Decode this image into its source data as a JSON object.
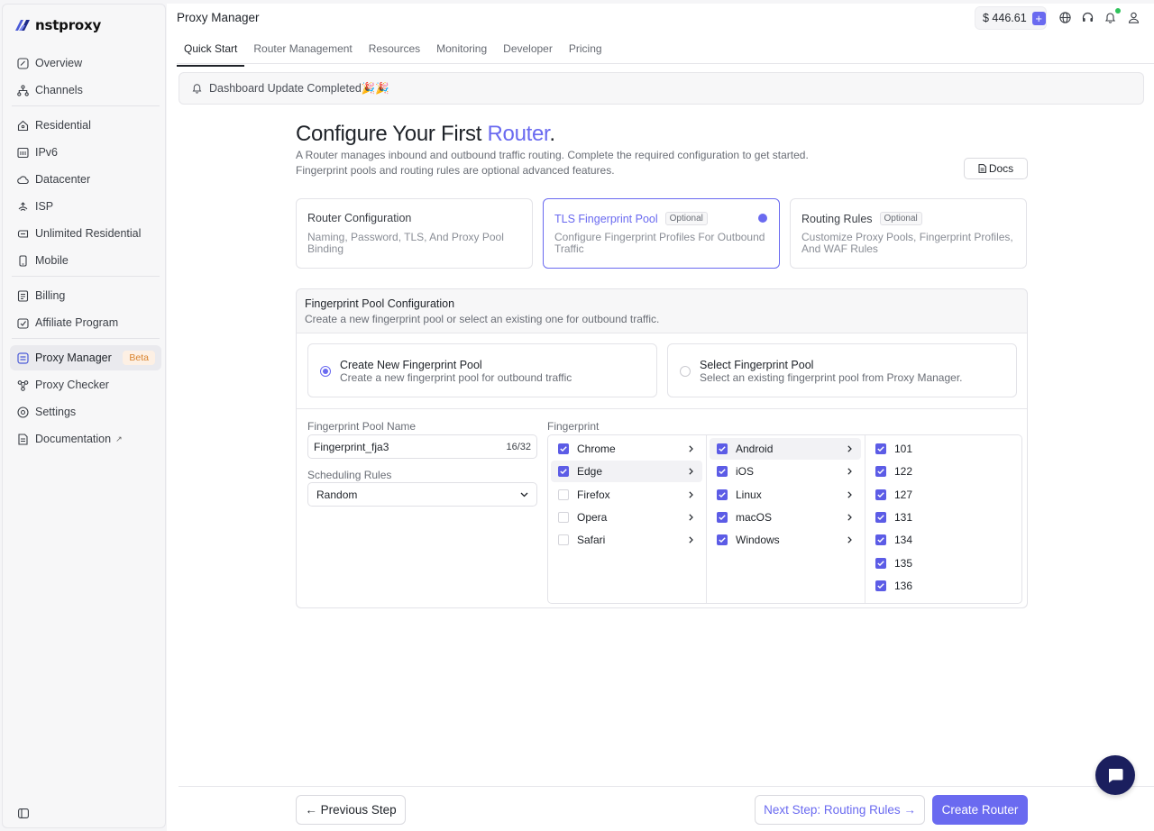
{
  "app": {
    "brand": "nstproxy"
  },
  "sidebar": {
    "groups": [
      [
        {
          "label": "Overview",
          "icon": "overview-icon"
        },
        {
          "label": "Channels",
          "icon": "channels-icon"
        }
      ],
      [
        {
          "label": "Residential",
          "icon": "residential-icon"
        },
        {
          "label": "IPv6",
          "icon": "ipv6-icon"
        },
        {
          "label": "Datacenter",
          "icon": "datacenter-icon"
        },
        {
          "label": "ISP",
          "icon": "isp-icon"
        },
        {
          "label": "Unlimited Residential",
          "icon": "unlimited-icon"
        },
        {
          "label": "Mobile",
          "icon": "mobile-icon"
        }
      ],
      [
        {
          "label": "Billing",
          "icon": "billing-icon"
        },
        {
          "label": "Affiliate Program",
          "icon": "affiliate-icon"
        }
      ],
      [
        {
          "label": "Proxy Manager",
          "icon": "proxy-manager-icon",
          "badge": "Beta",
          "active": true
        },
        {
          "label": "Proxy Checker",
          "icon": "proxy-checker-icon"
        },
        {
          "label": "Settings",
          "icon": "settings-icon"
        },
        {
          "label": "Documentation",
          "icon": "documentation-icon",
          "external": "↗"
        }
      ]
    ]
  },
  "header": {
    "title": "Proxy Manager",
    "balance": "$ 446.61",
    "tabs": [
      "Quick Start",
      "Router Management",
      "Resources",
      "Monitoring",
      "Developer",
      "Pricing"
    ],
    "active_tab": 0
  },
  "banner": {
    "text": "Dashboard Update Completed🎉🎉"
  },
  "page": {
    "heading_pre": "Configure Your First ",
    "heading_accent": "Router",
    "heading_post": ".",
    "subtext_1": "A Router manages inbound and outbound traffic routing. Complete the required configuration to get started.",
    "subtext_2": "Fingerprint pools and routing rules are optional advanced features.",
    "docs_label": "Docs"
  },
  "steps": [
    {
      "title": "Router Configuration",
      "optional": "",
      "desc": "Naming, Password, TLS, And Proxy Pool Binding",
      "active": false
    },
    {
      "title": "TLS Fingerprint Pool",
      "optional": "Optional",
      "desc": "Configure Fingerprint Profiles For Outbound Traffic",
      "active": true
    },
    {
      "title": "Routing Rules",
      "optional": "Optional",
      "desc": "Customize Proxy Pools, Fingerprint Profiles, And WAF Rules",
      "active": false
    }
  ],
  "panel": {
    "title": "Fingerprint Pool Configuration",
    "subtitle": "Create a new fingerprint pool or select an existing one for outbound traffic.",
    "choices": [
      {
        "title": "Create New Fingerprint Pool",
        "desc": "Create a new fingerprint pool for outbound traffic",
        "selected": true
      },
      {
        "title": "Select Fingerprint Pool",
        "desc": "Select an existing fingerprint pool from Proxy Manager.",
        "selected": false
      }
    ],
    "pool_name_label": "Fingerprint Pool Name",
    "pool_name_value": "Fingerprint_fja3",
    "pool_name_counter": "16/32",
    "scheduling_label": "Scheduling Rules",
    "scheduling_value": "Random",
    "fingerprint_label": "Fingerprint",
    "browsers": [
      {
        "name": "Chrome",
        "checked": true,
        "highlight": false
      },
      {
        "name": "Edge",
        "checked": true,
        "highlight": true
      },
      {
        "name": "Firefox",
        "checked": false,
        "highlight": false
      },
      {
        "name": "Opera",
        "checked": false,
        "highlight": false
      },
      {
        "name": "Safari",
        "checked": false,
        "highlight": false
      }
    ],
    "systems": [
      {
        "name": "Android",
        "checked": true,
        "highlight": true
      },
      {
        "name": "iOS",
        "checked": true,
        "highlight": false
      },
      {
        "name": "Linux",
        "checked": true,
        "highlight": false
      },
      {
        "name": "macOS",
        "checked": true,
        "highlight": false
      },
      {
        "name": "Windows",
        "checked": true,
        "highlight": false
      }
    ],
    "versions": [
      {
        "name": "101",
        "checked": true
      },
      {
        "name": "122",
        "checked": true
      },
      {
        "name": "127",
        "checked": true
      },
      {
        "name": "131",
        "checked": true
      },
      {
        "name": "134",
        "checked": true
      },
      {
        "name": "135",
        "checked": true
      },
      {
        "name": "136",
        "checked": true
      }
    ]
  },
  "footer": {
    "prev_label": "← Previous Step",
    "next_label": "Next Step: Routing Rules →",
    "create_label": "Create Router"
  },
  "colors": {
    "accent": "#6a6af0",
    "chat": "#1b1f5e",
    "beta_text": "#d9822b"
  }
}
